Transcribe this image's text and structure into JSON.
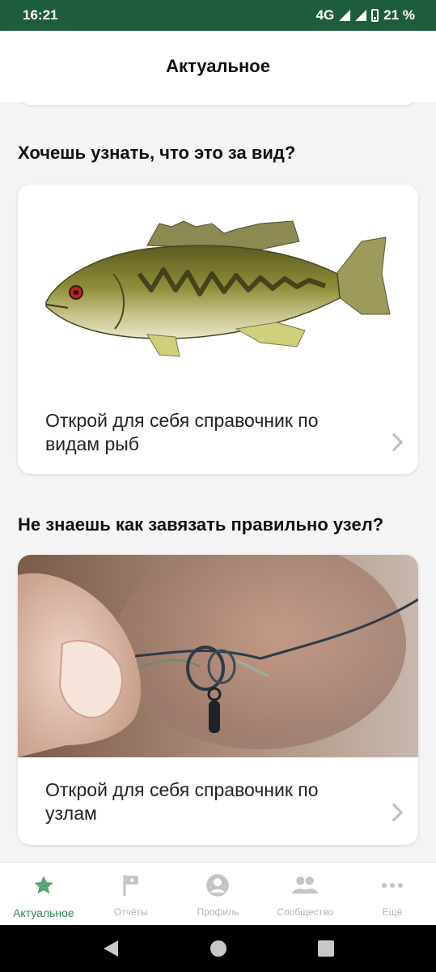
{
  "status_bar": {
    "time": "16:21",
    "network": "4G",
    "battery": "21 %"
  },
  "app_bar": {
    "title": "Актуальное"
  },
  "sections": [
    {
      "title": "Хочешь узнать, что это за вид?",
      "card_text": "Открой для себя справочник по видам рыб",
      "image": "fish-illustration"
    },
    {
      "title": "Не знаешь как завязать правильно узел?",
      "card_text": "Открой для себя справочник по узлам",
      "image": "knot-photo"
    }
  ],
  "bottom_nav": {
    "items": [
      {
        "label": "Актуальное",
        "icon": "star-icon",
        "active": true
      },
      {
        "label": "Отчёты",
        "icon": "flag-icon",
        "active": false
      },
      {
        "label": "Профиль",
        "icon": "profile-icon",
        "active": false
      },
      {
        "label": "Сообщество",
        "icon": "people-icon",
        "active": false
      },
      {
        "label": "Ещё",
        "icon": "more-icon",
        "active": false
      }
    ]
  },
  "colors": {
    "status_bar": "#1e5c3e",
    "accent": "#2e8a4e",
    "inactive": "#b3b3b3"
  }
}
